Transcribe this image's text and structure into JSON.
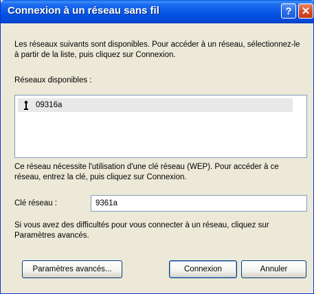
{
  "window": {
    "title": "Connexion à un réseau sans fil",
    "help_glyph": "?",
    "close_glyph": "✕"
  },
  "intro_text": "Les réseaux suivants sont disponibles. Pour accéder à un réseau, sélectionnez-le à partir de la liste, puis cliquez sur Connexion.",
  "networks_label": "Réseaux disponibles :",
  "networks": [
    {
      "name": "09316a",
      "icon": "wireless-antenna-icon",
      "selected": true
    }
  ],
  "wep_text": "Ce réseau nécessite l'utilisation d'une clé réseau (WEP). Pour accéder à ce réseau, entrez la clé, puis cliquez sur Connexion.",
  "key_label": "Clé réseau :",
  "key_value": "9361a",
  "help_text": "Si vous avez des difficultés pour vous connecter à un réseau, cliquez sur Paramètres avancés.",
  "buttons": {
    "advanced": "Paramètres avancés...",
    "connect": "Connexion",
    "cancel": "Annuler"
  }
}
